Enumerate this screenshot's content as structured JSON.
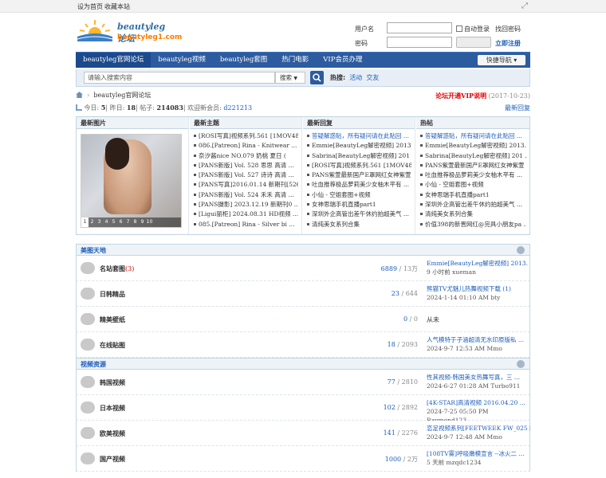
{
  "topbar": {
    "set_home": "设为首页",
    "bookmark": "收藏本站"
  },
  "logo": {
    "name": "beautyleg论坛",
    "domain": "beautyleg1.com"
  },
  "login": {
    "username_label": "用户名",
    "password_label": "密码",
    "auto_login": "自动登录",
    "find_password": "找回密码",
    "register": "立即注册"
  },
  "nav": {
    "items": [
      "beautyleg官网论坛",
      "beautyleg视频",
      "beautyleg套图",
      "热门电影",
      "VIP会员办理"
    ],
    "quick": "快捷导航"
  },
  "search": {
    "placeholder": "请输入搜索内容",
    "select": "搜索",
    "hot_label": "热搜:",
    "hot": [
      "活动",
      "交友"
    ]
  },
  "breadcrumb": {
    "site": "beautyleg官网论坛"
  },
  "vip": {
    "link": "论坛开通VIP说明",
    "date": "(2017-10-23)"
  },
  "stats": {
    "today_label": "今日:",
    "today": "5",
    "yesterday_label": "昨日:",
    "yesterday": "18",
    "posts_label": "帖子:",
    "posts": "214083",
    "welcome": "欢迎新会员:",
    "member": "d221213",
    "newest_reply": "最新回复"
  },
  "panels": {
    "images_title": "最新图片",
    "image_indices": [
      "1",
      "2",
      "3",
      "4",
      "5",
      "6",
      "7",
      "8",
      "9",
      "10"
    ],
    "topics_title": "最新主题",
    "topics": [
      "[ROSI写真]视频系列.561 [1MOV48 ...",
      "086.[Patreon] Rina - Knitwear ...",
      "奈汐酱nice NO.079 奶桃 夏日 (",
      "[PANS新版] Vol. 528 思思 高清 ...",
      "[PANS新版] Vol. 527 诗诗 高清 ...",
      "[PANS写真]2016.01.14 新期刊[526 ...",
      "[PANS新版] Vol. 524 禾禾 高清 ...",
      "[PANS摄影] 2023.12.19 新期刊0 ...",
      "[Ligui丽柜] 2024.08.31 HD视频 ...",
      "085.[Patreon] Rina - Silver bi ..."
    ],
    "replies_title": "最新回复",
    "replies": [
      "答疑解惑贴，所有疑问请在此贴回 ...",
      "Emmie[BeautyLeg解密视频] 2013. ...",
      "Sabrina[BeautyLeg解密视频] 201 ...",
      "[ROSI写真]视频系列.561 [1MOV48 ...",
      "PANS紫萱最新国产E罩网红女神紫萱 ...",
      "吐血推荐极品萝莉美少女柚木平有 ...",
      "小仙 - 空姐套图+视频",
      "女神思瑞手机直播part1",
      "深圳外企高管出差午休约拍超美气 ...",
      "清纯美女系列合集"
    ],
    "hot_title": "热帖",
    "hot": [
      "答疑解惑贴，所有疑问请在此贴回 ...",
      "Emmie[BeautyLeg解密视频] 2013. ...",
      "Sabrina[BeautyLeg解密视频] 201 ...",
      "PANS紫萱最新国产E罩网红女神紫萱 ...",
      "吐血推荐极品萝莉美少女柚木平有 ...",
      "小仙 - 空姐套图+视频",
      "女神思瑞手机直播part1",
      "深圳外企高管出差午休约拍超美气 ...",
      "清纯美女系列合集",
      "价值398的新晋网红@完具小朋友pa ..."
    ]
  },
  "sections": [
    {
      "title": "美图天地",
      "forums": [
        {
          "name": "名站套图",
          "count": "(3)",
          "threads": "6889",
          "posts": "13万",
          "last_title": "Emmie[BeautyLeg解密视频] 2013. ...",
          "last_meta": "9 小时前 xueman"
        },
        {
          "name": "日韩精品",
          "count": "",
          "threads": "23",
          "posts": "644",
          "last_title": "熊猫TV尤魅儿热舞视频下载 (1)",
          "last_meta": "2024-1-14 01:10 AM bty"
        },
        {
          "name": "精美壁纸",
          "count": "",
          "threads": "0",
          "posts": "0",
          "never": "从未"
        },
        {
          "name": "在线贴图",
          "count": "",
          "threads": "18",
          "posts": "2093",
          "last_title": "人气模特于子涵超清无水印原版私 ...",
          "last_meta": "2024-9-7 12:53 AM Mmo"
        }
      ]
    },
    {
      "title": "视频资源",
      "forums": [
        {
          "name": "韩国视频",
          "count": "",
          "threads": "77",
          "posts": "2810",
          "last_title": "性其视频-韩国美女热舞写真，三 ...",
          "last_meta": "2024-6-27 01:28 AM Turbo911"
        },
        {
          "name": "日本视频",
          "count": "",
          "threads": "102",
          "posts": "2892",
          "last_title": "[4K-STAR]高清视频 2016.04.20 ...",
          "last_meta": "2024-7-25 05:50 PM Raymond123"
        },
        {
          "name": "欧美视频",
          "count": "",
          "threads": "141",
          "posts": "2276",
          "last_title": "恋足视频系列[FEETWEEK FW_025 [m ...",
          "last_meta": "2024-9-7 12:48 AM Mmo"
        },
        {
          "name": "国产视频",
          "count": "",
          "threads": "1000",
          "posts": "2万",
          "last_title": "[108TV雾]呼吸嫩模宣言 --冰火二 ...",
          "last_meta": "5 天前 mzqdc1234"
        }
      ]
    }
  ]
}
